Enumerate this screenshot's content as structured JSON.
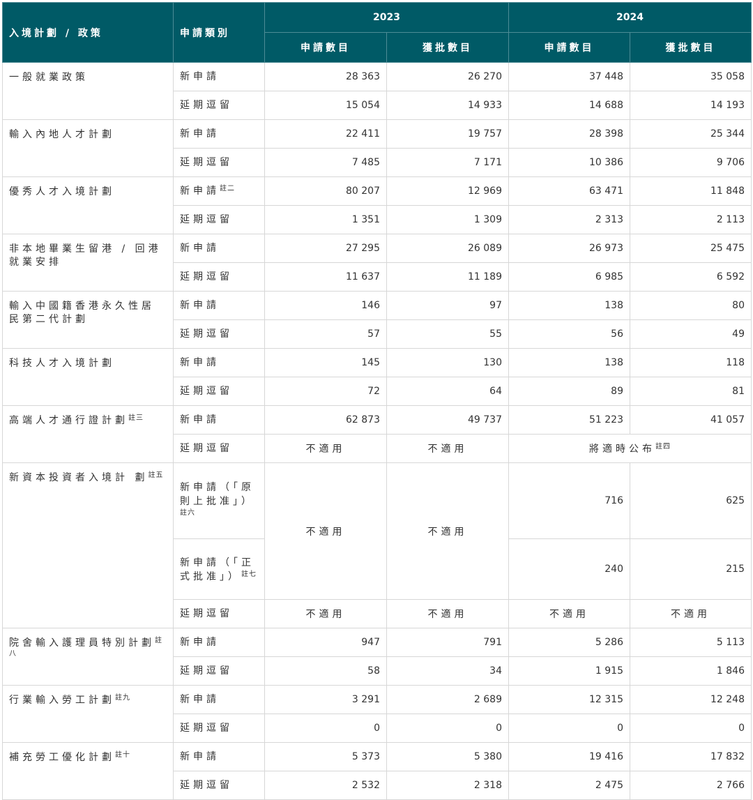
{
  "header": {
    "col_scheme": "入境計劃 / 政策",
    "col_category": "申請類別",
    "year_2023": "2023",
    "year_2024": "2024",
    "applications": "申請數目",
    "approvals": "獲批數目"
  },
  "labels": {
    "new": "新申請",
    "extension": "延期逗留",
    "na": "不適用",
    "pending": "將適時公布",
    "new_aip": "新申請（「原則上批准」）",
    "new_formal": "新申請（「正式批准」）"
  },
  "notes": {
    "n2": "註二",
    "n3": "註三",
    "n4": "註四",
    "n5": "註五",
    "n6": "註六",
    "n7": "註七",
    "n8": "註八",
    "n9": "註九",
    "n10": "註十"
  },
  "rows": [
    {
      "scheme": "一般就業政策",
      "new": [
        "28 363",
        "26 270",
        "37 448",
        "35 058"
      ],
      "ext": [
        "15 054",
        "14 933",
        "14 688",
        "14 193"
      ]
    },
    {
      "scheme": "輸入內地人才計劃",
      "new": [
        "22 411",
        "19 757",
        "28 398",
        "25 344"
      ],
      "ext": [
        "7 485",
        "7 171",
        "10 386",
        "9 706"
      ]
    },
    {
      "scheme": "優秀人才入境計劃",
      "new": [
        "80 207",
        "12 969",
        "63 471",
        "11 848"
      ],
      "ext": [
        "1 351",
        "1 309",
        "2 313",
        "2 113"
      ]
    },
    {
      "scheme": "非本地畢業生留港 / 回港就業安排",
      "new": [
        "27 295",
        "26 089",
        "26 973",
        "25 475"
      ],
      "ext": [
        "11 637",
        "11 189",
        "6 985",
        "6 592"
      ]
    },
    {
      "scheme": "輸入中國籍香港永久性居民第二代計劃",
      "new": [
        "146",
        "97",
        "138",
        "80"
      ],
      "ext": [
        "57",
        "55",
        "56",
        "49"
      ]
    },
    {
      "scheme": "科技人才入境計劃",
      "new": [
        "145",
        "130",
        "138",
        "118"
      ],
      "ext": [
        "72",
        "64",
        "89",
        "81"
      ]
    },
    {
      "scheme": "高端人才通行證計劃",
      "new": [
        "62 873",
        "49 737",
        "51 223",
        "41 057"
      ]
    },
    {
      "scheme": "新資本投資者入境計 劃",
      "aip": [
        "716",
        "625"
      ],
      "formal": [
        "240",
        "215"
      ]
    },
    {
      "scheme": "院舍輸入護理員特別計劃",
      "new": [
        "947",
        "791",
        "5 286",
        "5 113"
      ],
      "ext": [
        "58",
        "34",
        "1 915",
        "1 846"
      ]
    },
    {
      "scheme": "行業輸入勞工計劃",
      "new": [
        "3 291",
        "2 689",
        "12 315",
        "12 248"
      ],
      "ext": [
        "0",
        "0",
        "0",
        "0"
      ]
    },
    {
      "scheme": "補充勞工優化計劃",
      "new": [
        "5 373",
        "5 380",
        "19 416",
        "17 832"
      ],
      "ext": [
        "2 532",
        "2 318",
        "2 475",
        "2 766"
      ]
    }
  ]
}
